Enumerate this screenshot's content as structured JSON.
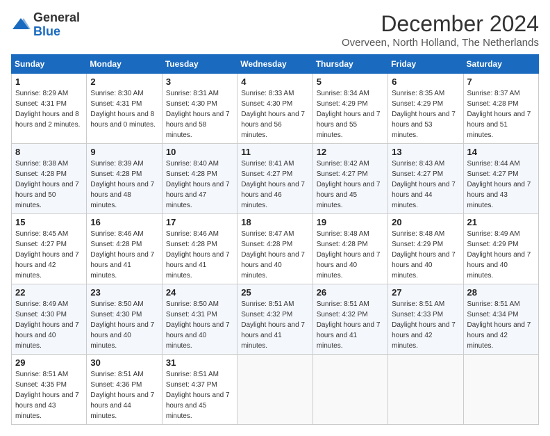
{
  "header": {
    "logo_general": "General",
    "logo_blue": "Blue",
    "title": "December 2024",
    "location": "Overveen, North Holland, The Netherlands"
  },
  "columns": [
    "Sunday",
    "Monday",
    "Tuesday",
    "Wednesday",
    "Thursday",
    "Friday",
    "Saturday"
  ],
  "weeks": [
    [
      {
        "day": "1",
        "sunrise": "8:29 AM",
        "sunset": "4:31 PM",
        "daylight": "8 hours and 2 minutes."
      },
      {
        "day": "2",
        "sunrise": "8:30 AM",
        "sunset": "4:31 PM",
        "daylight": "8 hours and 0 minutes."
      },
      {
        "day": "3",
        "sunrise": "8:31 AM",
        "sunset": "4:30 PM",
        "daylight": "7 hours and 58 minutes."
      },
      {
        "day": "4",
        "sunrise": "8:33 AM",
        "sunset": "4:30 PM",
        "daylight": "7 hours and 56 minutes."
      },
      {
        "day": "5",
        "sunrise": "8:34 AM",
        "sunset": "4:29 PM",
        "daylight": "7 hours and 55 minutes."
      },
      {
        "day": "6",
        "sunrise": "8:35 AM",
        "sunset": "4:29 PM",
        "daylight": "7 hours and 53 minutes."
      },
      {
        "day": "7",
        "sunrise": "8:37 AM",
        "sunset": "4:28 PM",
        "daylight": "7 hours and 51 minutes."
      }
    ],
    [
      {
        "day": "8",
        "sunrise": "8:38 AM",
        "sunset": "4:28 PM",
        "daylight": "7 hours and 50 minutes."
      },
      {
        "day": "9",
        "sunrise": "8:39 AM",
        "sunset": "4:28 PM",
        "daylight": "7 hours and 48 minutes."
      },
      {
        "day": "10",
        "sunrise": "8:40 AM",
        "sunset": "4:28 PM",
        "daylight": "7 hours and 47 minutes."
      },
      {
        "day": "11",
        "sunrise": "8:41 AM",
        "sunset": "4:27 PM",
        "daylight": "7 hours and 46 minutes."
      },
      {
        "day": "12",
        "sunrise": "8:42 AM",
        "sunset": "4:27 PM",
        "daylight": "7 hours and 45 minutes."
      },
      {
        "day": "13",
        "sunrise": "8:43 AM",
        "sunset": "4:27 PM",
        "daylight": "7 hours and 44 minutes."
      },
      {
        "day": "14",
        "sunrise": "8:44 AM",
        "sunset": "4:27 PM",
        "daylight": "7 hours and 43 minutes."
      }
    ],
    [
      {
        "day": "15",
        "sunrise": "8:45 AM",
        "sunset": "4:27 PM",
        "daylight": "7 hours and 42 minutes."
      },
      {
        "day": "16",
        "sunrise": "8:46 AM",
        "sunset": "4:28 PM",
        "daylight": "7 hours and 41 minutes."
      },
      {
        "day": "17",
        "sunrise": "8:46 AM",
        "sunset": "4:28 PM",
        "daylight": "7 hours and 41 minutes."
      },
      {
        "day": "18",
        "sunrise": "8:47 AM",
        "sunset": "4:28 PM",
        "daylight": "7 hours and 40 minutes."
      },
      {
        "day": "19",
        "sunrise": "8:48 AM",
        "sunset": "4:28 PM",
        "daylight": "7 hours and 40 minutes."
      },
      {
        "day": "20",
        "sunrise": "8:48 AM",
        "sunset": "4:29 PM",
        "daylight": "7 hours and 40 minutes."
      },
      {
        "day": "21",
        "sunrise": "8:49 AM",
        "sunset": "4:29 PM",
        "daylight": "7 hours and 40 minutes."
      }
    ],
    [
      {
        "day": "22",
        "sunrise": "8:49 AM",
        "sunset": "4:30 PM",
        "daylight": "7 hours and 40 minutes."
      },
      {
        "day": "23",
        "sunrise": "8:50 AM",
        "sunset": "4:30 PM",
        "daylight": "7 hours and 40 minutes."
      },
      {
        "day": "24",
        "sunrise": "8:50 AM",
        "sunset": "4:31 PM",
        "daylight": "7 hours and 40 minutes."
      },
      {
        "day": "25",
        "sunrise": "8:51 AM",
        "sunset": "4:32 PM",
        "daylight": "7 hours and 41 minutes."
      },
      {
        "day": "26",
        "sunrise": "8:51 AM",
        "sunset": "4:32 PM",
        "daylight": "7 hours and 41 minutes."
      },
      {
        "day": "27",
        "sunrise": "8:51 AM",
        "sunset": "4:33 PM",
        "daylight": "7 hours and 42 minutes."
      },
      {
        "day": "28",
        "sunrise": "8:51 AM",
        "sunset": "4:34 PM",
        "daylight": "7 hours and 42 minutes."
      }
    ],
    [
      {
        "day": "29",
        "sunrise": "8:51 AM",
        "sunset": "4:35 PM",
        "daylight": "7 hours and 43 minutes."
      },
      {
        "day": "30",
        "sunrise": "8:51 AM",
        "sunset": "4:36 PM",
        "daylight": "7 hours and 44 minutes."
      },
      {
        "day": "31",
        "sunrise": "8:51 AM",
        "sunset": "4:37 PM",
        "daylight": "7 hours and 45 minutes."
      },
      null,
      null,
      null,
      null
    ]
  ]
}
